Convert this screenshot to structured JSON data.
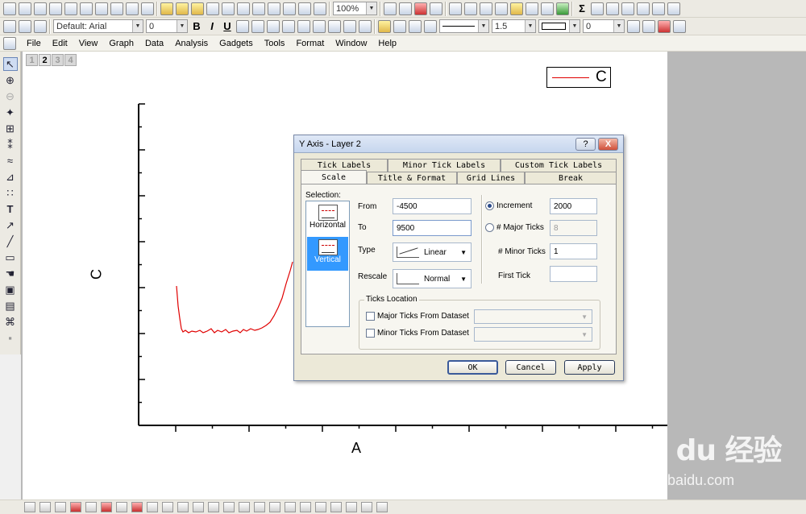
{
  "toolbar": {
    "zoom": "100%",
    "font_name": "Default: Arial",
    "font_size": "0",
    "bold": "B",
    "italic": "I",
    "underline": "U",
    "line_width": "1.5",
    "symbol_size": "0",
    "sigma": "Σ"
  },
  "menu": [
    "File",
    "Edit",
    "View",
    "Graph",
    "Data",
    "Analysis",
    "Gadgets",
    "Tools",
    "Format",
    "Window",
    "Help"
  ],
  "layer_tabs": [
    "1",
    "2",
    "3",
    "4"
  ],
  "graph": {
    "legend_label": "C",
    "y_axis_label": "C",
    "x_axis_label": "A",
    "series_color": "#e00000"
  },
  "dialog": {
    "title": "Y Axis - Layer 2",
    "help_button": "?",
    "close_button": "X",
    "tabs_top": [
      "Tick Labels",
      "Minor Tick Labels",
      "Custom Tick Labels"
    ],
    "tabs_bottom": [
      "Scale",
      "Title & Format",
      "Grid Lines",
      "Break"
    ],
    "selection_label": "Selection:",
    "selection_items": [
      "Horizontal",
      "Vertical"
    ],
    "from_label": "From",
    "from_value": "-4500",
    "to_label": "To",
    "to_value": "9500",
    "type_label": "Type",
    "type_value": "Linear",
    "rescale_label": "Rescale",
    "rescale_value": "Normal",
    "increment_label": "Increment",
    "increment_value": "2000",
    "major_ticks_label": "# Major Ticks",
    "major_ticks_value": "8",
    "minor_ticks_label": "# Minor Ticks",
    "minor_ticks_value": "1",
    "first_tick_label": "First Tick",
    "first_tick_value": "",
    "ticks_location_label": "Ticks Location",
    "major_from_dataset": "Major Ticks From Dataset",
    "minor_from_dataset": "Minor Ticks From Dataset",
    "ok": "OK",
    "cancel": "Cancel",
    "apply": "Apply"
  },
  "watermark": {
    "logo": "Bai du 经验",
    "url": "jingyan.baidu.com"
  }
}
